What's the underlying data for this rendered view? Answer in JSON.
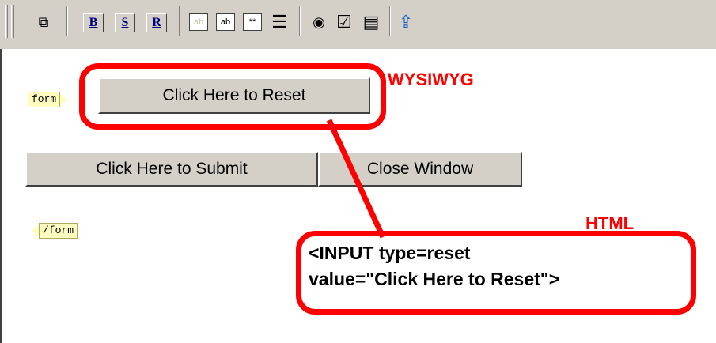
{
  "toolbar": {
    "buttons": [
      {
        "name": "properties",
        "icon": "page-icon",
        "glyph": "⧉"
      },
      {
        "name": "bold",
        "icon": "bold-format",
        "label": "B"
      },
      {
        "name": "strike",
        "icon": "strike-format",
        "label": "S"
      },
      {
        "name": "reset-style",
        "icon": "regular-format",
        "label": "R"
      },
      {
        "name": "text-disabled",
        "icon": "textbox-disabled-icon",
        "label": "ab"
      },
      {
        "name": "textbox",
        "icon": "textbox-icon",
        "label": "ab"
      },
      {
        "name": "password",
        "icon": "password-field-icon",
        "label": "**"
      },
      {
        "name": "textarea",
        "icon": "textarea-icon",
        "glyph": "☰"
      },
      {
        "name": "radio",
        "icon": "radio-button-icon",
        "glyph": "◉"
      },
      {
        "name": "checkbox",
        "icon": "checkbox-icon",
        "glyph": "☑"
      },
      {
        "name": "listbox",
        "icon": "listbox-icon",
        "glyph": "▤"
      },
      {
        "name": "image-button",
        "icon": "image-button-icon",
        "glyph": "⇪"
      }
    ]
  },
  "editor": {
    "form_open_tag": "form",
    "form_close_tag": "/form",
    "reset_button": "Click Here to Reset",
    "submit_button": "Click Here to Submit",
    "close_button": "Close Window"
  },
  "annotations": {
    "wysiwyg_label": "WYSIWYG",
    "html_label": "HTML",
    "code_line1": "<INPUT type=reset",
    "code_line2": "value=\"Click Here to Reset\">",
    "color": "#ff0000"
  }
}
